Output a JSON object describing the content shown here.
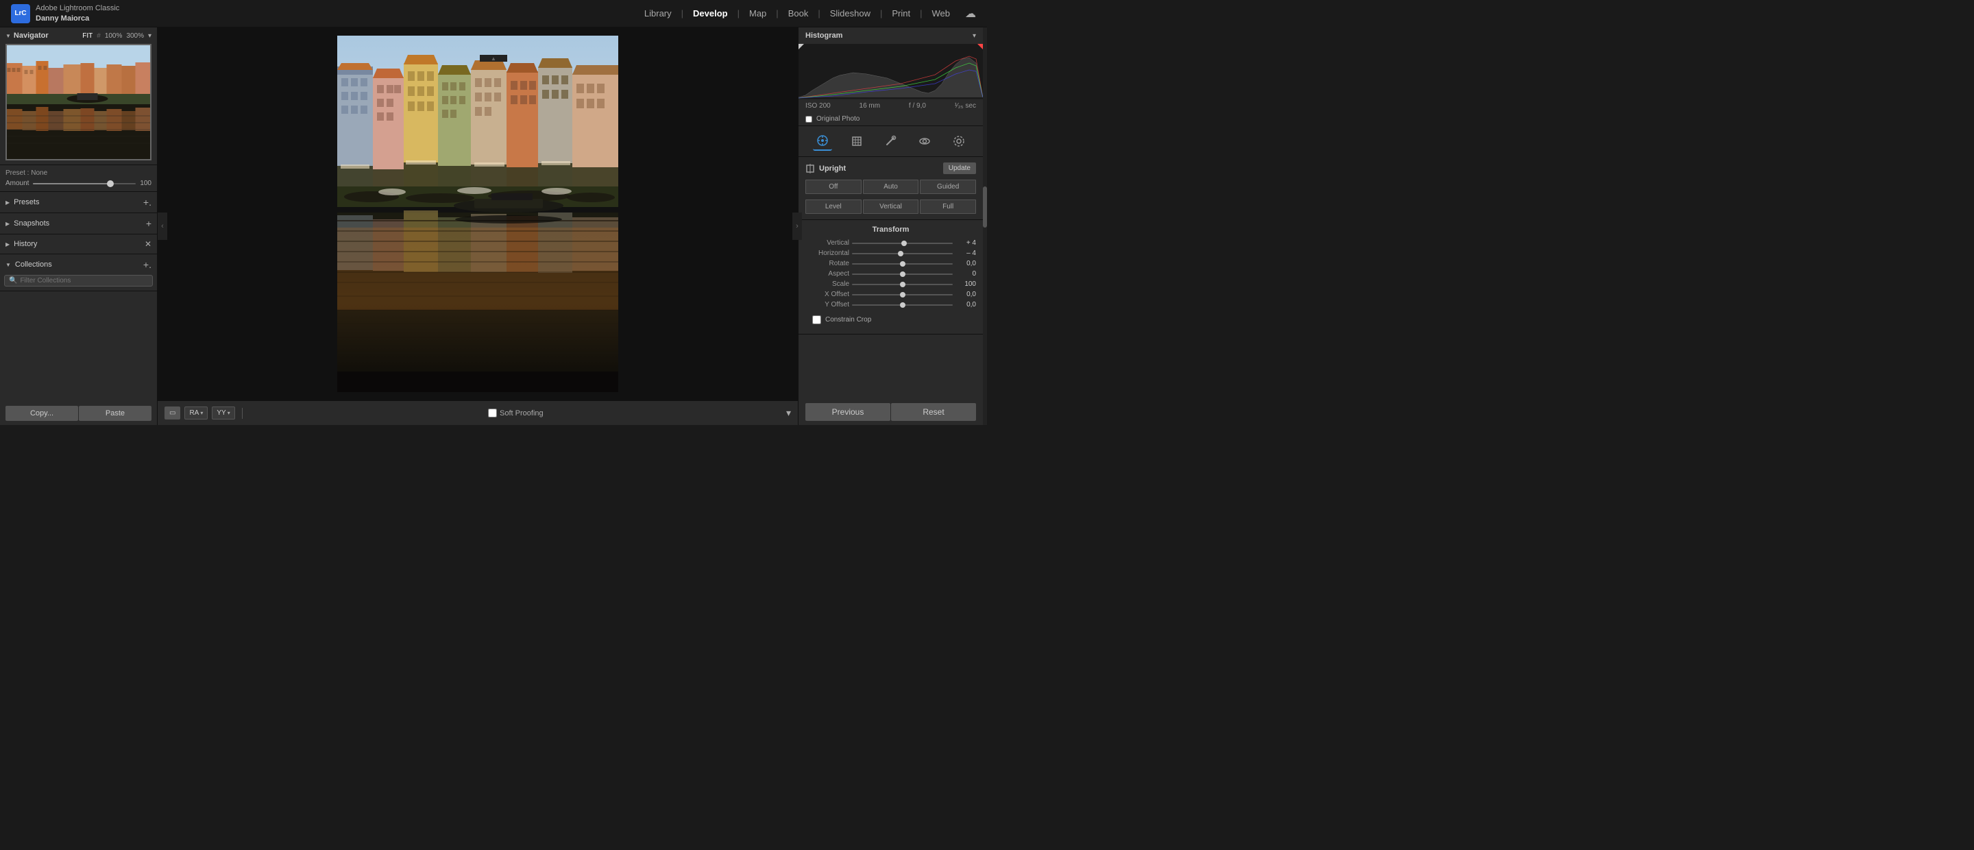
{
  "app": {
    "name": "Adobe Lightroom Classic",
    "user": "Danny Maiorca",
    "logo_text": "LrC"
  },
  "nav": {
    "items": [
      "Library",
      "Develop",
      "Map",
      "Book",
      "Slideshow",
      "Print",
      "Web"
    ],
    "active": "Develop",
    "separators": [
      true,
      false,
      true,
      true,
      true,
      true
    ]
  },
  "navigator": {
    "title": "Navigator",
    "zoom_fit": "FIT",
    "zoom_fit_symbol": "#",
    "zoom_100": "100%",
    "zoom_300": "300%"
  },
  "preset": {
    "label": "Preset : None",
    "amount_label": "Amount",
    "amount_value": "100",
    "slider_position_pct": 75
  },
  "left_panel": {
    "sections": [
      {
        "id": "presets",
        "label": "Presets",
        "collapsed": true,
        "has_plus": true,
        "has_x": false
      },
      {
        "id": "snapshots",
        "label": "Snapshots",
        "collapsed": true,
        "has_plus": true,
        "has_x": false
      },
      {
        "id": "history",
        "label": "History",
        "collapsed": true,
        "has_plus": false,
        "has_x": true
      },
      {
        "id": "collections",
        "label": "Collections",
        "collapsed": false,
        "has_plus": true,
        "has_x": false
      }
    ],
    "collections_filter_placeholder": "Filter Collections",
    "copy_btn": "Copy...",
    "paste_btn": "Paste"
  },
  "toolbar": {
    "frame_btn": "▭",
    "ra_btn": "RA",
    "yy_btn": "YY",
    "soft_proofing_label": "Soft Proofing",
    "soft_proofing_checked": false
  },
  "histogram": {
    "title": "Histogram",
    "exif": {
      "iso": "ISO 200",
      "focal": "16 mm",
      "aperture": "f / 9,0",
      "shutter": "¹⁄₂₅ sec"
    },
    "original_photo_label": "Original Photo"
  },
  "tools": {
    "icons": [
      {
        "id": "develop-presets",
        "symbol": "⊞",
        "active": true
      },
      {
        "id": "crop",
        "symbol": "⛶",
        "active": false
      },
      {
        "id": "heal",
        "symbol": "✒",
        "active": false
      },
      {
        "id": "red-eye",
        "symbol": "◎",
        "active": false
      },
      {
        "id": "masking",
        "symbol": "⊙",
        "active": false
      }
    ]
  },
  "upright": {
    "title": "Upright",
    "update_btn": "Update",
    "buttons_row1": [
      "Off",
      "Auto",
      "Guided"
    ],
    "buttons_row2": [
      "Level",
      "Vertical",
      "Full"
    ]
  },
  "transform": {
    "title": "Transform",
    "rows": [
      {
        "label": "Vertical",
        "value": "+ 4",
        "position_pct": 52
      },
      {
        "label": "Horizontal",
        "value": "– 4",
        "position_pct": 48
      },
      {
        "label": "Rotate",
        "value": "0,0",
        "position_pct": 50
      },
      {
        "label": "Aspect",
        "value": "0",
        "position_pct": 50
      },
      {
        "label": "Scale",
        "value": "100",
        "position_pct": 50
      },
      {
        "label": "X Offset",
        "value": "0,0",
        "position_pct": 50
      },
      {
        "label": "Y Offset",
        "value": "0,0",
        "position_pct": 50
      }
    ],
    "constrain_crop_label": "Constrain Crop"
  },
  "bottom_right": {
    "previous_btn": "Previous",
    "reset_btn": "Reset"
  }
}
